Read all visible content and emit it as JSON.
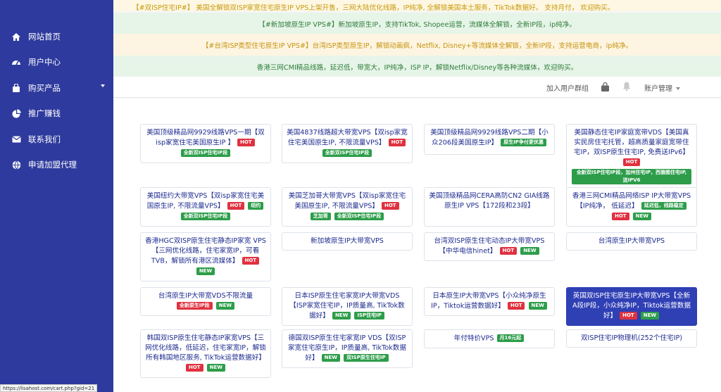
{
  "sidebar": {
    "items": [
      {
        "label": "网站首页",
        "icon": "home-icon"
      },
      {
        "label": "用户中心",
        "icon": "dashboard-icon"
      },
      {
        "label": "购买产品",
        "icon": "shopping-bag-icon"
      },
      {
        "label": "推广赚钱",
        "icon": "pie-chart-icon"
      },
      {
        "label": "联系我们",
        "icon": "envelope-icon"
      },
      {
        "label": "申请加盟代理",
        "icon": "globe-icon"
      }
    ]
  },
  "notices": [
    "【#双ISP住宅IP#】 美国全解锁双ISP家宽住宅原生IP VPS上架开售，三网大陆优化线路，IP纯净, 全解锁美国本土服务，TikTok数据好。 支持月付， 欢迎购买。",
    "【#新加坡原生IP VPS#】新加坡原生IP，支持TikTok, Shopee运营，流媒体全解锁，全新IP段，ip纯净。",
    "【#台湾ISP类型住宅原生IP VPS#】台湾ISP类型原生IP，解锁动画疯，Netflix, Disney+等流媒体全解锁，全新IP段，支持运营电商，ip纯净。",
    "香港三网CMI精品线路，延迟低，带宽大，IP纯净，ISP IP，解锁Netflix/Disney等各种流媒体，欢迎购买。"
  ],
  "topbar": {
    "join_group": "加入用户群组",
    "account": "账户管理"
  },
  "products": [
    {
      "title": "美国顶级精品网9929线路VPS一期【双isp家宽住宅美国原生IP 】",
      "badges": [
        {
          "text": "HOT",
          "kind": "hot"
        },
        {
          "text": "全新双ISP住宅IP段",
          "kind": "green"
        }
      ]
    },
    {
      "title": "美国4837线路超大带宽VPS【双isp家宽住宅美国原生IP, 不限流量VPS】",
      "badges": [
        {
          "text": "HOT",
          "kind": "hot"
        },
        {
          "text": "全新双ISP住宅IP段",
          "kind": "green"
        }
      ]
    },
    {
      "title": "美国顶级精品网9929线路VPS二期【小众206段美国原生IP】",
      "badges": [
        {
          "text": "原生IP争付更优惠",
          "kind": "green"
        }
      ]
    },
    {
      "title": "美国静态住宅IP家庭宽带VDS【美国真实民房住宅托管，超高质量家庭宽带住宅IP，双ISP原生住宅IP, 免费送IPv6】",
      "badges": [
        {
          "text": "HOT",
          "kind": "hot"
        },
        {
          "text": "全新双ISP住宅IP段，加州住宅IP，西雅图住宅IP,送IPV6",
          "kind": "green"
        }
      ]
    },
    {
      "title": "美国纽约大带宽VPS【双isp家宽住宅美国原生IP, 不限流量VPS】",
      "badges": [
        {
          "text": "HOT",
          "kind": "hot"
        },
        {
          "text": "纽约",
          "kind": "green"
        },
        {
          "text": "全新双ISP住宅IP段",
          "kind": "green"
        }
      ]
    },
    {
      "title": "美国芝加哥大带宽VPS【双isp家宽住宅美国原生IP, 不限流量VPS】",
      "badges": [
        {
          "text": "HOT",
          "kind": "hot"
        },
        {
          "text": "芝加哥",
          "kind": "green"
        },
        {
          "text": "全新双ISP住宅IP段",
          "kind": "green"
        }
      ]
    },
    {
      "title": "美国顶级精品网CERA高防CN2 GIA线路原生IP VPS【172段和23段】",
      "badges": []
    },
    {
      "title": "香港三网CMI精品网络ISP IP大带宽VPS【IP纯净， 低延迟】",
      "badges": [
        {
          "text": "延迟低，线路稳定",
          "kind": "green"
        },
        {
          "text": "HOT",
          "kind": "hot"
        },
        {
          "text": "NEW",
          "kind": "new"
        }
      ]
    },
    {
      "title": "香港HGC双ISP原生住宅静态IP家宽 VPS【三网优化线路，住宅家宽IP，可看TVB，解锁所有港区流媒体】",
      "badges": [
        {
          "text": "HOT",
          "kind": "hot"
        },
        {
          "text": "NEW",
          "kind": "new"
        }
      ]
    },
    {
      "title": "新加坡原生IP大带宽VPS",
      "badges": []
    },
    {
      "title": "台湾双ISP原生住宅动态IP大带宽VPS【中华电信hinet】",
      "badges": [
        {
          "text": "HOT",
          "kind": "hot"
        },
        {
          "text": "NEW",
          "kind": "new"
        }
      ]
    },
    {
      "title": "台湾原生IP大带宽VPS",
      "badges": []
    },
    {
      "title": "台湾原生IP大带宽VDS不限流量",
      "badges": [
        {
          "text": "全新原生IP段",
          "kind": "red"
        },
        {
          "text": "NEW",
          "kind": "new"
        }
      ]
    },
    {
      "title": "日本ISP原生住宅家宽IP大带宽VDS【ISP家宽住宅IP，IP质量高, TikTok数据好】",
      "badges": [
        {
          "text": "NEW",
          "kind": "new"
        },
        {
          "text": "ISP住宅IP",
          "kind": "green"
        }
      ]
    },
    {
      "title": "日本原生IP大带宽VPS【小众纯净原生IP，Tiktok运营数据好】",
      "badges": [
        {
          "text": "HOT",
          "kind": "hot"
        },
        {
          "text": "NEW",
          "kind": "new"
        }
      ]
    },
    {
      "title": "英国双ISP住宅原生IP大带宽VPS【全新A段IP段，小众纯净IP，Tiktok运营数据好】",
      "badges": [
        {
          "text": "HOT",
          "kind": "hot"
        },
        {
          "text": "NEW",
          "kind": "new"
        }
      ]
    },
    {
      "title": "韩国双ISP原生住宅静态IP家宽VPS【三网优化线路，低延迟，住宅家宽IP，解锁所有韩国地区服务, TikTok运营数据好】",
      "badges": [
        {
          "text": "HOT",
          "kind": "hot"
        },
        {
          "text": "NEW",
          "kind": "new"
        }
      ]
    },
    {
      "title": "德国双ISP原生住宅家宽IP VDS【双ISP家宽住宅原生IP，IP质量高, TikTok数据好】",
      "badges": [
        {
          "text": "NEW",
          "kind": "new"
        },
        {
          "text": "双ISP原生住宅IP",
          "kind": "green"
        }
      ]
    },
    {
      "title": "年付特价VPS",
      "badges": [
        {
          "text": "月16元起",
          "kind": "green"
        }
      ]
    },
    {
      "title": "双ISP住宅IP物理机(252个住宅IP)",
      "badges": []
    }
  ],
  "status_url": "https://lisahost.com/cart.php?gid=21"
}
